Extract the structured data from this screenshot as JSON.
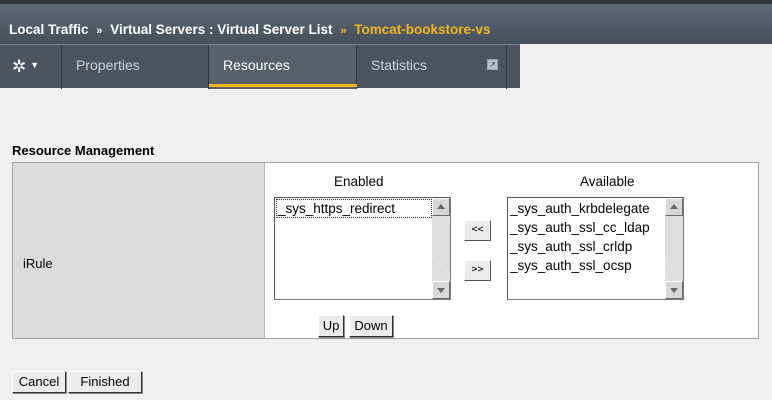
{
  "breadcrumb": {
    "items": [
      "Local Traffic",
      "Virtual Servers : Virtual Server List"
    ],
    "separator": "»",
    "current": "Tomcat-bookstore-vs"
  },
  "tabs": {
    "gear_icon": "gear-icon",
    "items": [
      {
        "label": "Properties"
      },
      {
        "label": "Resources",
        "selected": true
      },
      {
        "label": "Statistics"
      }
    ],
    "popout_glyph": "↗"
  },
  "section": {
    "title": "Resource Management"
  },
  "irule": {
    "label": "iRule",
    "enabled_header": "Enabled",
    "available_header": "Available",
    "enabled": [
      "_sys_https_redirect"
    ],
    "available": [
      "_sys_auth_krbdelegate",
      "_sys_auth_ssl_cc_ldap",
      "_sys_auth_ssl_crldp",
      "_sys_auth_ssl_ocsp"
    ],
    "move_left": "<<",
    "move_right": ">>",
    "up": "Up",
    "down": "Down"
  },
  "actions": {
    "cancel": "Cancel",
    "finished": "Finished"
  },
  "colors": {
    "accent": "#f5b417",
    "header_bg": "#4a5460"
  }
}
